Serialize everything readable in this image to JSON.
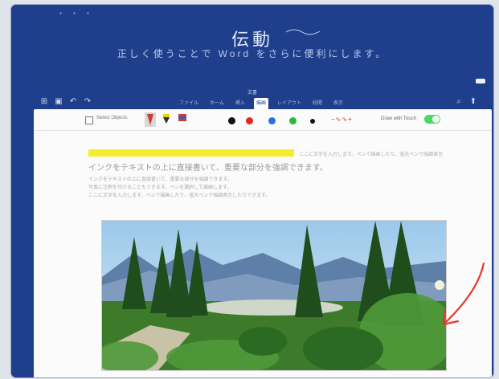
{
  "document": {
    "title": "伝動",
    "subtitle": "正しく使うことで Word をさらに便利にします。",
    "file_name": "文書"
  },
  "app_bar": {
    "tabs": [
      {
        "label": "ファイル",
        "active": false
      },
      {
        "label": "ホーム",
        "active": false
      },
      {
        "label": "挿入",
        "active": false
      },
      {
        "label": "描画",
        "active": true
      },
      {
        "label": "レイアウト",
        "active": false
      },
      {
        "label": "校閲",
        "active": false
      },
      {
        "label": "表示",
        "active": false
      }
    ]
  },
  "ribbon": {
    "lasso_label": "Select Objects",
    "touch_label": "Draw with Touch",
    "touch_enabled": true,
    "pen_colors": [
      "#d23b30",
      "#f2d400",
      "#3b5cc6"
    ],
    "ink_colors": [
      "#111111",
      "#e0281e",
      "#2f6fe0",
      "#2eb83c",
      "#111111"
    ],
    "thickness_label": "−∿∿+"
  },
  "body": {
    "lines": [
      "ここに文字を入力します。ペンで描画したり、蛍光ペンで強調表示したりできます。",
      "インクをテキストの上に直接書いて、重要な部分を強調できます。",
      "写真に注釈を付けることもできます。ペンを選択して描画します。"
    ]
  },
  "annotation": {
    "type": "red-arrow",
    "color": "#e23a2b"
  },
  "colors": {
    "accent": "#1f3f8c",
    "highlight": "#f2ee2e",
    "toggle_on": "#4cd964"
  }
}
